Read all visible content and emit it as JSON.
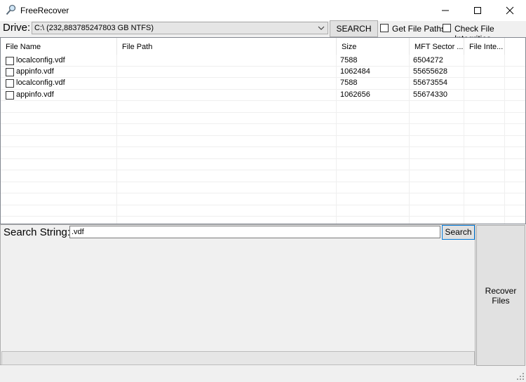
{
  "window": {
    "title": "FreeRecover",
    "icon": "magnifier-icon",
    "controls": [
      "minimize-icon",
      "maximize-icon",
      "close-icon"
    ]
  },
  "drive": {
    "label": "Drive:",
    "selected": "C:\\ (232,883785247803 GB NTFS)",
    "search_button": "SEARCH",
    "get_file_paths": {
      "label": "Get File Paths",
      "checked": false
    },
    "check_integrities": {
      "label": "Check File Integrities",
      "checked": false
    }
  },
  "table": {
    "columns": [
      "File Name",
      "File Path",
      "Size",
      "MFT Sector ...",
      "File Inte..."
    ],
    "rows": [
      {
        "name": "localconfig.vdf",
        "path": "",
        "size": "7588",
        "mft": "6504272",
        "integrity": ""
      },
      {
        "name": "appinfo.vdf",
        "path": "",
        "size": "1062484",
        "mft": "55655628",
        "integrity": ""
      },
      {
        "name": "localconfig.vdf",
        "path": "",
        "size": "7588",
        "mft": "55673554",
        "integrity": ""
      },
      {
        "name": "appinfo.vdf",
        "path": "",
        "size": "1062656",
        "mft": "55674330",
        "integrity": ""
      }
    ]
  },
  "search": {
    "label": "Search String:",
    "value": ".vdf",
    "button": "Search"
  },
  "recover": {
    "line1": "Recover",
    "line2": "Files"
  }
}
